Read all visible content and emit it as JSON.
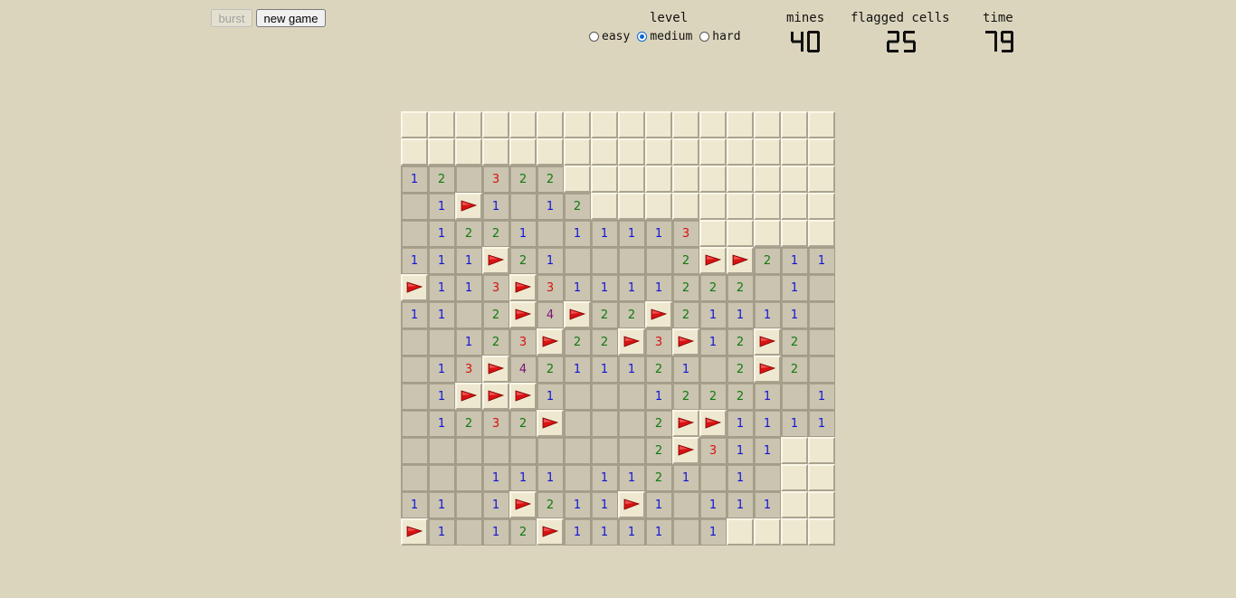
{
  "toolbar": {
    "burst_label": "burst",
    "new_game_label": "new game"
  },
  "level": {
    "label": "level",
    "options": [
      {
        "label": "easy",
        "selected": false
      },
      {
        "label": "medium",
        "selected": true
      },
      {
        "label": "hard",
        "selected": false
      }
    ]
  },
  "mines": {
    "label": "mines",
    "value": "40"
  },
  "flagged": {
    "label": "flagged cells",
    "value": "25"
  },
  "time": {
    "label": "time",
    "value": "79"
  },
  "colors": {
    "background": "#dcd5bd",
    "flag": "#d81212",
    "n1": "#1212d8",
    "n2": "#117a11",
    "n3": "#d81212",
    "n4": "#7a127a"
  },
  "legend": {
    "closed": "#",
    "flag": "F",
    "empty": ".",
    "numbers": "1-8"
  },
  "board": [
    "################",
    "################",
    "12.322##########",
    ".1F1.12#########",
    ".1221.11113#####",
    "111F21....2FF211",
    "F113F31111222.1.",
    "11.2F4F22F21111.",
    "..123F22F3F12F2.",
    ".13F4211121.2F2.",
    ".1FFF1...12221.1",
    ".1232F...2FF1111",
    ".........2F311##",
    "...111.1121.1.##",
    "11.1F211F1.111##",
    "F1.12F1111.1####"
  ]
}
